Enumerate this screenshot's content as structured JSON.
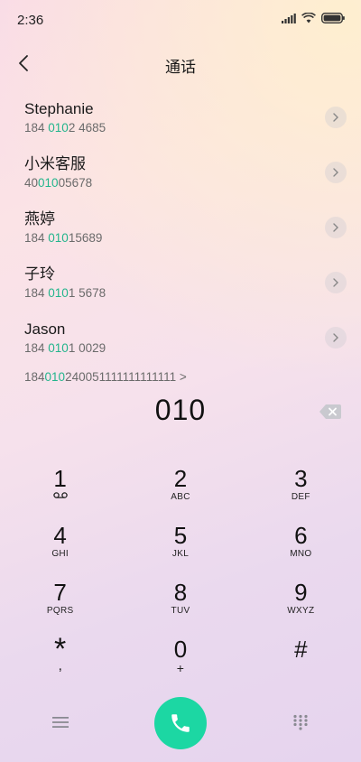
{
  "status_bar": {
    "time": "2:36",
    "icons": [
      "signal-icon",
      "wifi-icon",
      "battery-icon"
    ]
  },
  "header": {
    "title": "通话",
    "back_icon": "chevron-left-icon"
  },
  "contacts": [
    {
      "name": "Stephanie",
      "number_pre": "184 ",
      "number_match": "010",
      "number_post": "2 4685"
    },
    {
      "name": "小米客服",
      "number_pre": "40",
      "number_match": "010",
      "number_post": "05678"
    },
    {
      "name": "燕婷",
      "number_pre": "184 ",
      "number_match": "010",
      "number_post": "15689"
    },
    {
      "name": "子玲",
      "number_pre": "184 ",
      "number_match": "010",
      "number_post": "1 5678"
    },
    {
      "name": "Jason",
      "number_pre": "184 ",
      "number_match": "010",
      "number_post": "1 0029"
    }
  ],
  "partial_row": {
    "pre": "184",
    "match": "010",
    "post": "240051111111111111 >"
  },
  "dialer": {
    "number": "010",
    "delete_icon": "backspace-icon"
  },
  "keypad": [
    [
      {
        "digit": "1",
        "letters": "voicemail-icon"
      },
      {
        "digit": "2",
        "letters": "ABC"
      },
      {
        "digit": "3",
        "letters": "DEF"
      }
    ],
    [
      {
        "digit": "4",
        "letters": "GHI"
      },
      {
        "digit": "5",
        "letters": "JKL"
      },
      {
        "digit": "6",
        "letters": "MNO"
      }
    ],
    [
      {
        "digit": "7",
        "letters": "PQRS"
      },
      {
        "digit": "8",
        "letters": "TUV"
      },
      {
        "digit": "9",
        "letters": "WXYZ"
      }
    ],
    [
      {
        "digit": "*",
        "letters": ","
      },
      {
        "digit": "0",
        "letters": "+"
      },
      {
        "digit": "#",
        "letters": ""
      }
    ]
  ],
  "bottom_bar": {
    "menu_icon": "menu-icon",
    "call_icon": "phone-icon",
    "keypad_icon": "dialpad-icon"
  },
  "colors": {
    "accent_green": "#23b58c",
    "call_button": "#1cd7a3"
  }
}
